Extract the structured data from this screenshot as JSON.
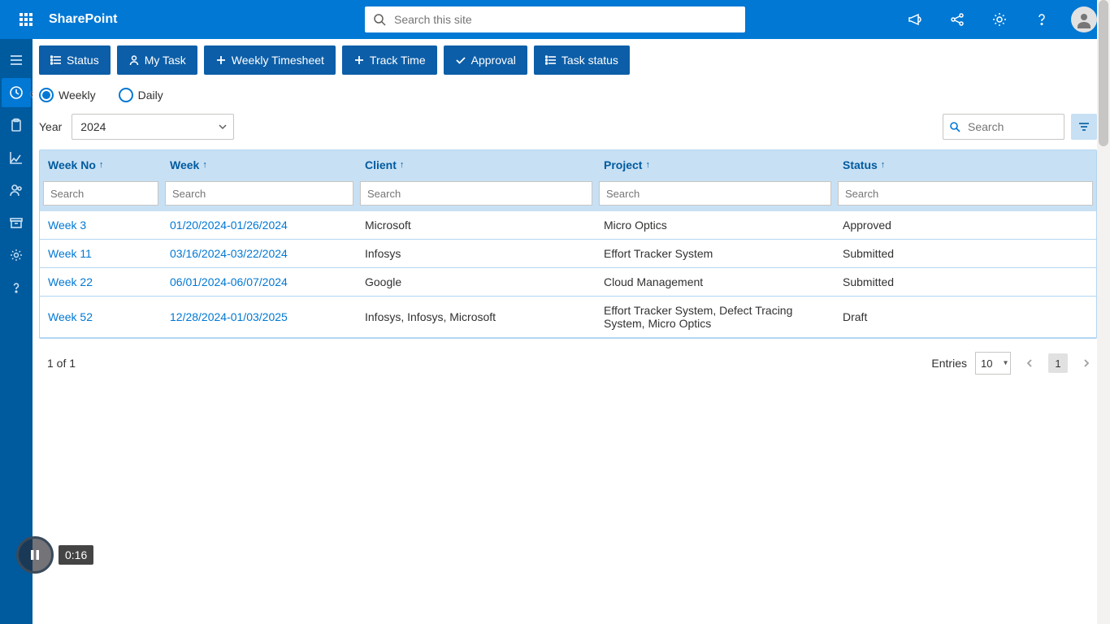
{
  "top": {
    "brand": "SharePoint",
    "search_placeholder": "Search this site"
  },
  "toolbar": {
    "status": "Status",
    "my_task": "My Task",
    "weekly_timesheet": "Weekly Timesheet",
    "track_time": "Track Time",
    "approval": "Approval",
    "task_status": "Task status"
  },
  "view": {
    "weekly": "Weekly",
    "daily": "Daily"
  },
  "year": {
    "label": "Year",
    "value": "2024"
  },
  "table_search_placeholder": "Search",
  "columns": {
    "week_no": "Week No",
    "week": "Week",
    "client": "Client",
    "project": "Project",
    "status": "Status",
    "filter_placeholder": "Search"
  },
  "rows": [
    {
      "week_no": "Week 3",
      "week": "01/20/2024-01/26/2024",
      "client": "Microsoft",
      "project": "Micro Optics",
      "status": "Approved"
    },
    {
      "week_no": "Week 11",
      "week": "03/16/2024-03/22/2024",
      "client": "Infosys",
      "project": "Effort Tracker System",
      "status": "Submitted"
    },
    {
      "week_no": "Week 22",
      "week": "06/01/2024-06/07/2024",
      "client": "Google",
      "project": "Cloud Management",
      "status": "Submitted"
    },
    {
      "week_no": "Week 52",
      "week": "12/28/2024-01/03/2025",
      "client": "Infosys, Infosys, Microsoft",
      "project": "Effort Tracker System, Defect Tracing System, Micro Optics",
      "status": "Draft"
    }
  ],
  "pager": {
    "info": "1 of 1",
    "entries_label": "Entries",
    "entries_value": "10",
    "current_page": "1"
  },
  "overlay": {
    "time": "0:16"
  }
}
